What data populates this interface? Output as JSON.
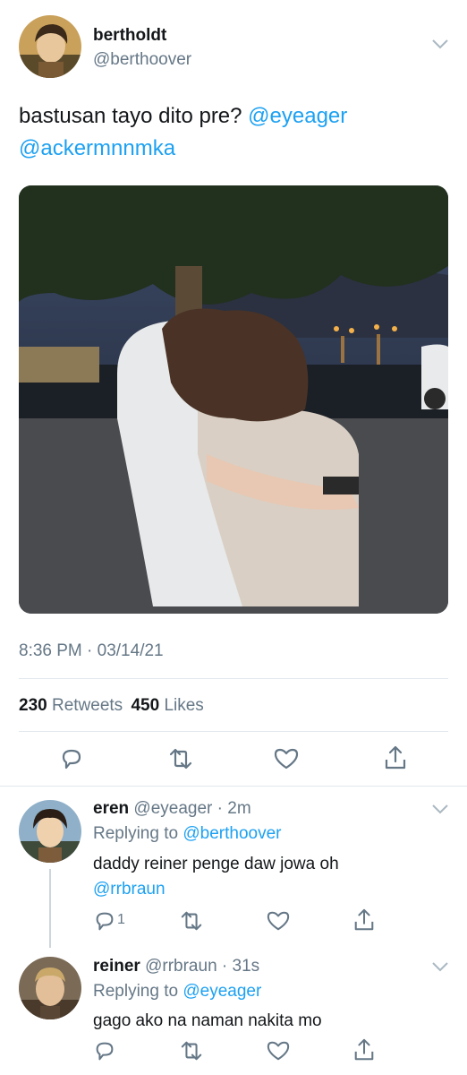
{
  "tweet": {
    "display_name": "bertholdt",
    "handle": "@berthoover",
    "text_plain": "bastusan tayo dito pre? ",
    "mention_1": "@eyeager",
    "mention_2": "@ackermnnmka",
    "timestamp": "8:36 PM · 03/14/21",
    "retweets_count": "230",
    "retweets_label": "Retweets",
    "likes_count": "450",
    "likes_label": "Likes",
    "actions": [
      "reply-icon",
      "retweet-icon",
      "like-icon",
      "share-icon"
    ]
  },
  "replies": [
    {
      "display_name": "eren",
      "handle": "@eyeager",
      "time": "· 2m",
      "replying_label": "Replying to ",
      "replying_to": "@berthoover",
      "text_plain": "daddy reiner penge daw jowa oh",
      "mention": "@rrbraun",
      "reply_count": "1"
    },
    {
      "display_name": "reiner",
      "handle": "@rrbraun",
      "time": "· 31s",
      "replying_label": "Replying to ",
      "replying_to": "@eyeager",
      "text_plain": "gago ako na naman nakita mo"
    }
  ],
  "colors": {
    "accent": "#1da1f2",
    "muted": "#657786",
    "divider": "#e1e8ed"
  }
}
